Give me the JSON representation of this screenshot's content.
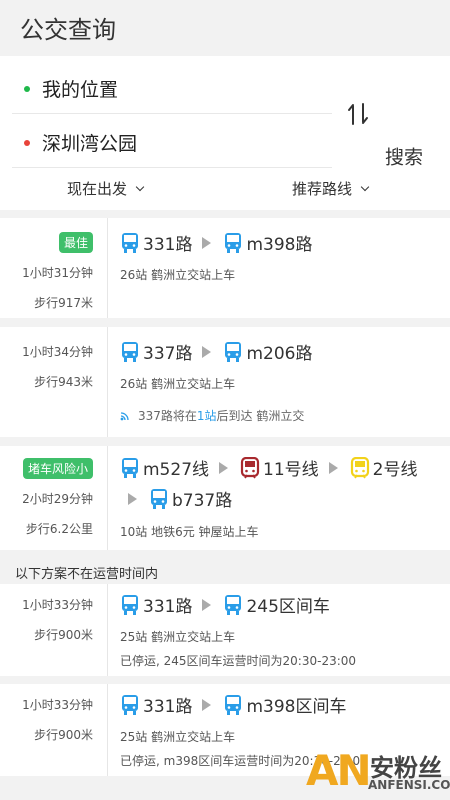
{
  "header": {
    "title": "公交查询"
  },
  "search": {
    "origin": "我的位置",
    "destination": "深圳湾公园",
    "search_label": "搜索",
    "filter_time": "现在出发",
    "filter_pref": "推荐路线"
  },
  "colors": {
    "green_dot": "#1fb84a",
    "red_dot": "#e8433a",
    "bus_blue": "#2a9de8",
    "subway_red": "#a8292e",
    "subway_yellow": "#f2d21b",
    "badge_green": "#3fbf6a"
  },
  "results": [
    {
      "badge": "最佳",
      "duration": "1小时31分钟",
      "walk": "步行917米",
      "seg1": "331路",
      "seg2": "m398路",
      "sub": "26站  鹤洲立交站上车"
    },
    {
      "duration": "1小时34分钟",
      "walk": "步行943米",
      "seg1": "337路",
      "seg2": "m206路",
      "sub": "26站  鹤洲立交站上车",
      "rt_pre": "337路将在",
      "rt_hi": "1站",
      "rt_post": "后到达 鹤洲立交"
    },
    {
      "badge": "堵车风险小",
      "duration": "2小时29分钟",
      "walk": "步行6.2公里",
      "seg1": "m527线",
      "seg2": "11号线",
      "seg3": "2号线",
      "seg4": "b737路",
      "sub": "10站 地铁6元 钟屋站上车"
    }
  ],
  "section_label": "以下方案不在运营时间内",
  "offline": [
    {
      "duration": "1小时33分钟",
      "walk": "步行900米",
      "seg1": "331路",
      "seg2": "245区间车",
      "sub": "25站  鹤洲立交站上车",
      "note": "已停运, 245区间车运营时间为20:30-23:00"
    },
    {
      "duration": "1小时33分钟",
      "walk": "步行900米",
      "seg1": "331路",
      "seg2": "m398区间车",
      "sub": "25站  鹤洲立交站上车",
      "note": "已停运, m398区间车运营时间为20:30-23:00"
    }
  ],
  "watermark": {
    "logo": "AN",
    "name": "安粉丝",
    "url": "ANFENSI.COM"
  }
}
